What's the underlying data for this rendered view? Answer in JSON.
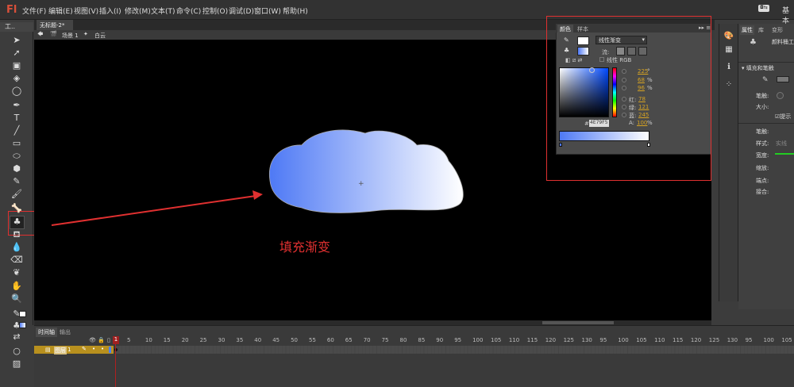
{
  "app": {
    "logo": "Fl",
    "workspace": "基本"
  },
  "menu": [
    "文件(F)",
    "编辑(E)",
    "视图(V)",
    "插入(I)",
    "修改(M)",
    "文本(T)",
    "命令(C)",
    "控制(O)",
    "调试(D)",
    "窗口(W)",
    "帮助(H)"
  ],
  "toolbar": {
    "title": "工.."
  },
  "document": {
    "tab": "无标题-2*",
    "close": "×",
    "scene": "场景 1",
    "symbol": "白云"
  },
  "annotation": "填充渐变",
  "color_panel": {
    "tabs": [
      "颜色",
      "样本"
    ],
    "type": "线性渐变",
    "flow_label": "流:",
    "linear_rgb": "线性 RGB",
    "h": "225",
    "h_unit": "°",
    "s": "68",
    "s_unit": "%",
    "b": "96",
    "b_unit": "%",
    "red_label": "红:",
    "red": "78",
    "green_label": "绿:",
    "green": "121",
    "blue_label": "蓝:",
    "blue": "245",
    "alpha_label": "A:",
    "alpha": "100",
    "alpha_unit": "%",
    "hex_label": "#",
    "hex": "4E79F5",
    "gradient_start": "#4e79f5",
    "gradient_end": "#ffffff"
  },
  "properties": {
    "tabs": [
      "属性",
      "库",
      "变形"
    ],
    "tool_name": "颜料桶工",
    "section": "填充和笔触",
    "labels": [
      "笔触:",
      "大小:",
      "笔触:",
      "样式:",
      "宽度:",
      "缩放:",
      "端点:",
      "接合:"
    ],
    "checkbox": "提示",
    "style_value": "实线"
  },
  "timeline": {
    "tabs": [
      "时间轴",
      "输出"
    ],
    "layer_name": "图层",
    "layer_num": "1",
    "frame_labels": [
      "1",
      "5",
      "10",
      "15",
      "20",
      "25",
      "30",
      "35",
      "40",
      "45",
      "50",
      "55",
      "60",
      "65",
      "70",
      "75",
      "80",
      "85",
      "90",
      "95",
      "100",
      "105",
      "110",
      "115",
      "120",
      "125",
      "130",
      "95",
      "100",
      "105",
      "110",
      "115",
      "120",
      "125",
      "130",
      "95",
      "100",
      "105"
    ]
  }
}
